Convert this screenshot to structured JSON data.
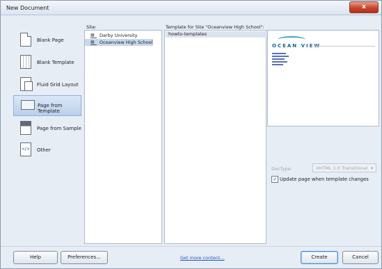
{
  "window": {
    "title": "New Document",
    "close_label": "x"
  },
  "categories": [
    {
      "label": "Blank Page",
      "icon": "blank-page-icon"
    },
    {
      "label": "Blank Template",
      "icon": "blank-template-icon"
    },
    {
      "label": "Fluid Grid Layout",
      "icon": "fluid-grid-icon"
    },
    {
      "label": "Page from Template",
      "icon": "page-from-template-icon",
      "selected": true
    },
    {
      "label": "Page from Sample",
      "icon": "page-from-sample-icon"
    },
    {
      "label": "Other",
      "icon": "other-icon",
      "icon_glyph": "</>"
    }
  ],
  "site": {
    "header": "Site:",
    "items": [
      {
        "label": "Darby University"
      },
      {
        "label": "Oceanview High School",
        "selected": true
      }
    ]
  },
  "templates": {
    "header": "Template for Site \"Oceanview High School\":",
    "items": [
      {
        "label": "howto-templates",
        "selected": true
      }
    ]
  },
  "preview": {
    "logo_text": "OCEAN VIEW"
  },
  "doctype": {
    "label": "DocType:",
    "value": "XHTML 1.0 Transitional"
  },
  "update_checkbox": {
    "label": "Update page when template changes",
    "checked": true
  },
  "footer": {
    "help": "Help",
    "preferences": "Preferences...",
    "more_content": "Get more content...",
    "create": "Create",
    "cancel": "Cancel"
  }
}
